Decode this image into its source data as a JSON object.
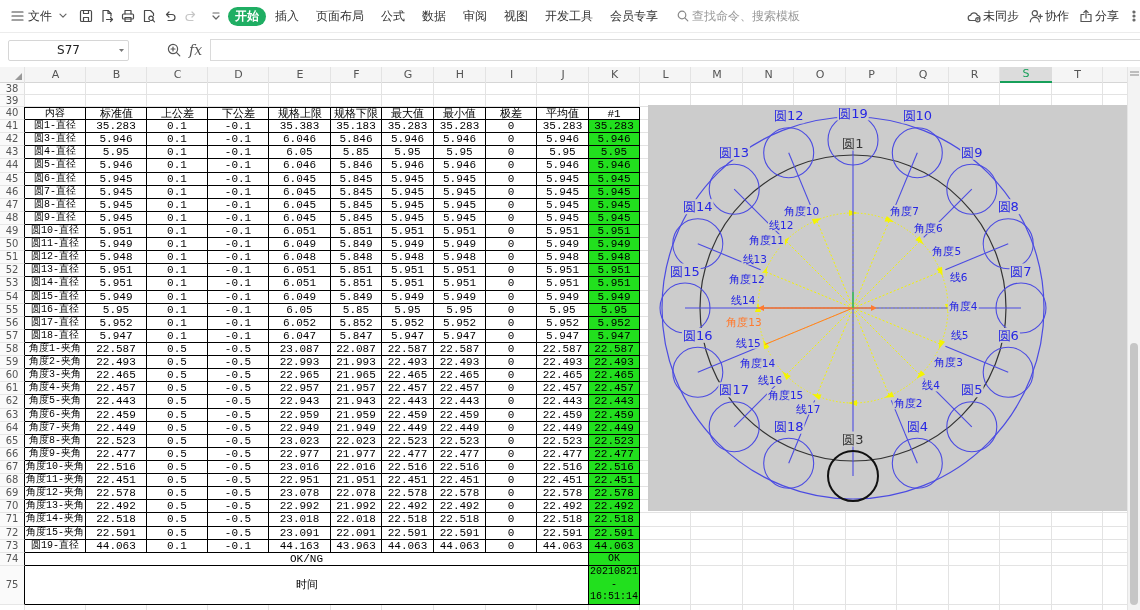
{
  "toolbar": {
    "file_menu": "文件",
    "quick_access": [
      {
        "kind": "save",
        "disabled": false
      },
      {
        "kind": "export",
        "disabled": false
      },
      {
        "kind": "print",
        "disabled": false
      },
      {
        "kind": "preview",
        "disabled": false
      },
      {
        "kind": "undo",
        "disabled": false
      },
      {
        "kind": "redo",
        "disabled": true
      }
    ],
    "tabs": [
      {
        "label": "开始",
        "selected": true
      },
      {
        "label": "插入",
        "selected": false
      },
      {
        "label": "页面布局",
        "selected": false
      },
      {
        "label": "公式",
        "selected": false
      },
      {
        "label": "数据",
        "selected": false
      },
      {
        "label": "审阅",
        "selected": false
      },
      {
        "label": "视图",
        "selected": false
      },
      {
        "label": "开发工具",
        "selected": false
      },
      {
        "label": "会员专享",
        "selected": false
      }
    ],
    "search": {
      "placeholder": "查找命令、搜索模板"
    },
    "actions": [
      {
        "kind": "sync",
        "label": "未同步"
      },
      {
        "kind": "collaborate",
        "label": "协作"
      },
      {
        "kind": "share",
        "label": "分享"
      }
    ]
  },
  "formula_bar": {
    "name_box": "S77",
    "function_label": "fx"
  },
  "sheet": {
    "column_headers": [
      {
        "label": "A",
        "selected": false
      },
      {
        "label": "B",
        "selected": false
      },
      {
        "label": "C",
        "selected": false
      },
      {
        "label": "D",
        "selected": false
      },
      {
        "label": "E",
        "selected": false
      },
      {
        "label": "F",
        "selected": false
      },
      {
        "label": "G",
        "selected": false
      },
      {
        "label": "H",
        "selected": false
      },
      {
        "label": "I",
        "selected": false
      },
      {
        "label": "J",
        "selected": false
      },
      {
        "label": "K",
        "selected": false
      },
      {
        "label": "L",
        "selected": false
      },
      {
        "label": "M",
        "selected": false
      },
      {
        "label": "N",
        "selected": false
      },
      {
        "label": "O",
        "selected": false
      },
      {
        "label": "P",
        "selected": false
      },
      {
        "label": "Q",
        "selected": false
      },
      {
        "label": "R",
        "selected": false
      },
      {
        "label": "S",
        "selected": true
      },
      {
        "label": "T",
        "selected": false
      }
    ],
    "rows": [
      {
        "number": "38",
        "kind": "blank"
      },
      {
        "number": "39",
        "kind": "blank"
      },
      {
        "number": "40",
        "kind": "header",
        "cells": [
          "内容",
          "标准值",
          "上公差",
          "下公差",
          "规格上限",
          "规格下限",
          "最大值",
          "最小值",
          "极差",
          "平均值",
          "#1"
        ]
      },
      {
        "number": "41",
        "kind": "data",
        "pass": true,
        "cells": [
          "圆1-直径",
          "35.283",
          "0.1",
          "-0.1",
          "35.383",
          "35.183",
          "35.283",
          "35.283",
          "0",
          "35.283",
          "35.283"
        ]
      },
      {
        "number": "42",
        "kind": "data",
        "pass": true,
        "cells": [
          "圆3-直径",
          "5.946",
          "0.1",
          "-0.1",
          "6.046",
          "5.846",
          "5.946",
          "5.946",
          "0",
          "5.946",
          "5.946"
        ]
      },
      {
        "number": "43",
        "kind": "data",
        "pass": true,
        "cells": [
          "圆4-直径",
          "5.95",
          "0.1",
          "-0.1",
          "6.05",
          "5.85",
          "5.95",
          "5.95",
          "0",
          "5.95",
          "5.95"
        ]
      },
      {
        "number": "44",
        "kind": "data",
        "pass": true,
        "cells": [
          "圆5-直径",
          "5.946",
          "0.1",
          "-0.1",
          "6.046",
          "5.846",
          "5.946",
          "5.946",
          "0",
          "5.946",
          "5.946"
        ]
      },
      {
        "number": "45",
        "kind": "data",
        "pass": true,
        "cells": [
          "圆6-直径",
          "5.945",
          "0.1",
          "-0.1",
          "6.045",
          "5.845",
          "5.945",
          "5.945",
          "0",
          "5.945",
          "5.945"
        ]
      },
      {
        "number": "46",
        "kind": "data",
        "pass": true,
        "cells": [
          "圆7-直径",
          "5.945",
          "0.1",
          "-0.1",
          "6.045",
          "5.845",
          "5.945",
          "5.945",
          "0",
          "5.945",
          "5.945"
        ]
      },
      {
        "number": "47",
        "kind": "data",
        "pass": true,
        "cells": [
          "圆8-直径",
          "5.945",
          "0.1",
          "-0.1",
          "6.045",
          "5.845",
          "5.945",
          "5.945",
          "0",
          "5.945",
          "5.945"
        ]
      },
      {
        "number": "48",
        "kind": "data",
        "pass": true,
        "cells": [
          "圆9-直径",
          "5.945",
          "0.1",
          "-0.1",
          "6.045",
          "5.845",
          "5.945",
          "5.945",
          "0",
          "5.945",
          "5.945"
        ]
      },
      {
        "number": "49",
        "kind": "data",
        "pass": true,
        "cells": [
          "圆10-直径",
          "5.951",
          "0.1",
          "-0.1",
          "6.051",
          "5.851",
          "5.951",
          "5.951",
          "0",
          "5.951",
          "5.951"
        ]
      },
      {
        "number": "50",
        "kind": "data",
        "pass": true,
        "cells": [
          "圆11-直径",
          "5.949",
          "0.1",
          "-0.1",
          "6.049",
          "5.849",
          "5.949",
          "5.949",
          "0",
          "5.949",
          "5.949"
        ]
      },
      {
        "number": "51",
        "kind": "data",
        "pass": true,
        "cells": [
          "圆12-直径",
          "5.948",
          "0.1",
          "-0.1",
          "6.048",
          "5.848",
          "5.948",
          "5.948",
          "0",
          "5.948",
          "5.948"
        ]
      },
      {
        "number": "52",
        "kind": "data",
        "pass": true,
        "cells": [
          "圆13-直径",
          "5.951",
          "0.1",
          "-0.1",
          "6.051",
          "5.851",
          "5.951",
          "5.951",
          "0",
          "5.951",
          "5.951"
        ]
      },
      {
        "number": "53",
        "kind": "data",
        "pass": true,
        "cells": [
          "圆14-直径",
          "5.951",
          "0.1",
          "-0.1",
          "6.051",
          "5.851",
          "5.951",
          "5.951",
          "0",
          "5.951",
          "5.951"
        ]
      },
      {
        "number": "54",
        "kind": "data",
        "pass": true,
        "cells": [
          "圆15-直径",
          "5.949",
          "0.1",
          "-0.1",
          "6.049",
          "5.849",
          "5.949",
          "5.949",
          "0",
          "5.949",
          "5.949"
        ]
      },
      {
        "number": "55",
        "kind": "data",
        "pass": true,
        "cells": [
          "圆16-直径",
          "5.95",
          "0.1",
          "-0.1",
          "6.05",
          "5.85",
          "5.95",
          "5.95",
          "0",
          "5.95",
          "5.95"
        ]
      },
      {
        "number": "56",
        "kind": "data",
        "pass": true,
        "cells": [
          "圆17-直径",
          "5.952",
          "0.1",
          "-0.1",
          "6.052",
          "5.852",
          "5.952",
          "5.952",
          "0",
          "5.952",
          "5.952"
        ]
      },
      {
        "number": "57",
        "kind": "data",
        "pass": true,
        "cells": [
          "圆18-直径",
          "5.947",
          "0.1",
          "-0.1",
          "6.047",
          "5.847",
          "5.947",
          "5.947",
          "0",
          "5.947",
          "5.947"
        ]
      },
      {
        "number": "58",
        "kind": "data",
        "pass": true,
        "cells": [
          "角度1-夹角",
          "22.587",
          "0.5",
          "-0.5",
          "23.087",
          "22.087",
          "22.587",
          "22.587",
          "0",
          "22.587",
          "22.587"
        ]
      },
      {
        "number": "59",
        "kind": "data",
        "pass": true,
        "cells": [
          "角度2-夹角",
          "22.493",
          "0.5",
          "-0.5",
          "22.993",
          "21.993",
          "22.493",
          "22.493",
          "0",
          "22.493",
          "22.493"
        ]
      },
      {
        "number": "60",
        "kind": "data",
        "pass": true,
        "cells": [
          "角度3-夹角",
          "22.465",
          "0.5",
          "-0.5",
          "22.965",
          "21.965",
          "22.465",
          "22.465",
          "0",
          "22.465",
          "22.465"
        ]
      },
      {
        "number": "61",
        "kind": "data",
        "pass": true,
        "cells": [
          "角度4-夹角",
          "22.457",
          "0.5",
          "-0.5",
          "22.957",
          "21.957",
          "22.457",
          "22.457",
          "0",
          "22.457",
          "22.457"
        ]
      },
      {
        "number": "62",
        "kind": "data",
        "pass": true,
        "cells": [
          "角度5-夹角",
          "22.443",
          "0.5",
          "-0.5",
          "22.943",
          "21.943",
          "22.443",
          "22.443",
          "0",
          "22.443",
          "22.443"
        ]
      },
      {
        "number": "63",
        "kind": "data",
        "pass": true,
        "cells": [
          "角度6-夹角",
          "22.459",
          "0.5",
          "-0.5",
          "22.959",
          "21.959",
          "22.459",
          "22.459",
          "0",
          "22.459",
          "22.459"
        ]
      },
      {
        "number": "64",
        "kind": "data",
        "pass": true,
        "cells": [
          "角度7-夹角",
          "22.449",
          "0.5",
          "-0.5",
          "22.949",
          "21.949",
          "22.449",
          "22.449",
          "0",
          "22.449",
          "22.449"
        ]
      },
      {
        "number": "65",
        "kind": "data",
        "pass": true,
        "cells": [
          "角度8-夹角",
          "22.523",
          "0.5",
          "-0.5",
          "23.023",
          "22.023",
          "22.523",
          "22.523",
          "0",
          "22.523",
          "22.523"
        ]
      },
      {
        "number": "66",
        "kind": "data",
        "pass": true,
        "cells": [
          "角度9-夹角",
          "22.477",
          "0.5",
          "-0.5",
          "22.977",
          "21.977",
          "22.477",
          "22.477",
          "0",
          "22.477",
          "22.477"
        ]
      },
      {
        "number": "67",
        "kind": "data",
        "pass": true,
        "cells": [
          "角度10-夹角",
          "22.516",
          "0.5",
          "-0.5",
          "23.016",
          "22.016",
          "22.516",
          "22.516",
          "0",
          "22.516",
          "22.516"
        ]
      },
      {
        "number": "68",
        "kind": "data",
        "pass": true,
        "cells": [
          "角度11-夹角",
          "22.451",
          "0.5",
          "-0.5",
          "22.951",
          "21.951",
          "22.451",
          "22.451",
          "0",
          "22.451",
          "22.451"
        ]
      },
      {
        "number": "69",
        "kind": "data",
        "pass": true,
        "cells": [
          "角度12-夹角",
          "22.578",
          "0.5",
          "-0.5",
          "23.078",
          "22.078",
          "22.578",
          "22.578",
          "0",
          "22.578",
          "22.578"
        ]
      },
      {
        "number": "70",
        "kind": "data",
        "pass": true,
        "cells": [
          "角度13-夹角",
          "22.492",
          "0.5",
          "-0.5",
          "22.992",
          "21.992",
          "22.492",
          "22.492",
          "0",
          "22.492",
          "22.492"
        ]
      },
      {
        "number": "71",
        "kind": "data",
        "pass": true,
        "cells": [
          "角度14-夹角",
          "22.518",
          "0.5",
          "-0.5",
          "23.018",
          "22.018",
          "22.518",
          "22.518",
          "0",
          "22.518",
          "22.518"
        ]
      },
      {
        "number": "72",
        "kind": "data",
        "pass": true,
        "cells": [
          "角度15-夹角",
          "22.591",
          "0.5",
          "-0.5",
          "23.091",
          "22.091",
          "22.591",
          "22.591",
          "0",
          "22.591",
          "22.591"
        ]
      },
      {
        "number": "73",
        "kind": "data",
        "pass": true,
        "cells": [
          "圆19-直径",
          "44.063",
          "0.1",
          "-0.1",
          "44.163",
          "43.963",
          "44.063",
          "44.063",
          "0",
          "44.063",
          "44.063"
        ]
      },
      {
        "number": "74",
        "kind": "summary",
        "pass": true,
        "label": "OK/NG",
        "result": [
          "OK"
        ]
      },
      {
        "number": "75",
        "kind": "summary",
        "pass": true,
        "label": "时间",
        "result": [
          "20210821",
          "-",
          "16:51:14"
        ]
      }
    ]
  },
  "drawing": {
    "rings": [
      {
        "label": "圆19",
        "selected": false
      },
      {
        "label": "圆1",
        "selected": true
      }
    ],
    "circles": [
      {
        "selected": false
      },
      {
        "label": "圆10",
        "selected": false
      },
      {
        "label": "圆9",
        "selected": false
      },
      {
        "label": "圆8",
        "selected": false
      },
      {
        "label": "圆7",
        "selected": false
      },
      {
        "label": "圆6",
        "selected": false
      },
      {
        "label": "圆5",
        "selected": false
      },
      {
        "label": "圆4",
        "selected": false
      },
      {
        "label": "圆3",
        "selected": true
      },
      {
        "label": "圆18",
        "selected": false
      },
      {
        "label": "圆17",
        "selected": false
      },
      {
        "label": "圆16",
        "selected": false
      },
      {
        "label": "圆15",
        "selected": false
      },
      {
        "label": "圆14",
        "selected": false
      },
      {
        "label": "圆13",
        "selected": false
      },
      {
        "label": "圆12",
        "selected": false
      }
    ],
    "angle_labels_right": [
      {
        "text": "角度7",
        "selected": false
      },
      {
        "text": "角度6",
        "selected": false
      },
      {
        "text": "角度5",
        "selected": false
      },
      {
        "text": "线6",
        "selected": false
      },
      {
        "text": "角度4",
        "selected": false
      },
      {
        "text": "线5",
        "selected": false
      },
      {
        "text": "角度3",
        "selected": false
      },
      {
        "text": "线4",
        "selected": false
      },
      {
        "text": "角度2",
        "selected": false
      }
    ],
    "angle_labels_left": [
      {
        "text": "角度10",
        "selected": false
      },
      {
        "text": "线12",
        "selected": false
      },
      {
        "text": "角度11",
        "selected": false
      },
      {
        "text": "线13",
        "selected": false
      },
      {
        "text": "角度12",
        "selected": false
      },
      {
        "text": "线14",
        "selected": false
      },
      {
        "text": "角度13",
        "selected": true
      },
      {
        "text": "线15",
        "selected": false
      },
      {
        "text": "角度14",
        "selected": false
      },
      {
        "text": "线16",
        "selected": false
      },
      {
        "text": "角度15",
        "selected": false
      },
      {
        "text": "线17",
        "selected": false
      }
    ]
  }
}
